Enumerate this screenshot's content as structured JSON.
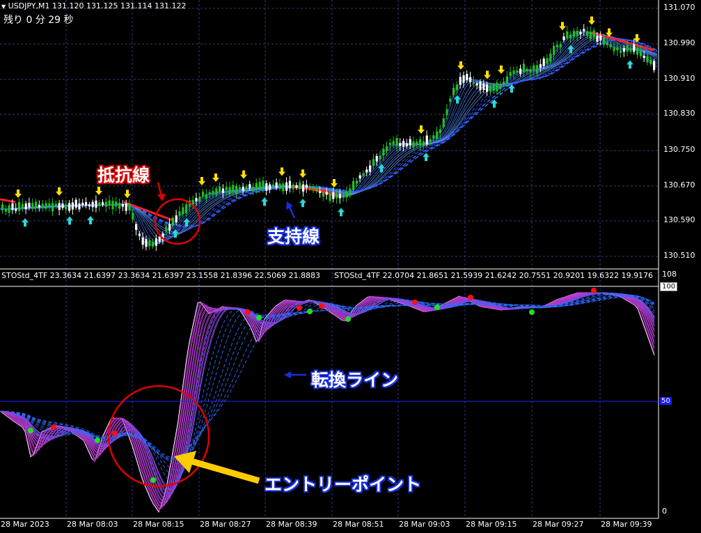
{
  "header": {
    "symbol_info": "USDJPY,M1  131.120 131.125 131.114 131.122",
    "time_left": "残り  0 分 29 秒",
    "indicator_info_left": "STOStd_4TF 23.3634 21.6397 23.3634 21.6397 23.1558 21.8396 22.5069 21.8883",
    "indicator_info_right": "STOStd_4TF 22.0704 21.8651 21.5939 21.6242 20.7551 20.9201 19.6322 19.9176"
  },
  "price_axis": {
    "labels": [
      "131.070",
      "130.990",
      "130.910",
      "130.830",
      "130.750",
      "130.670",
      "130.590",
      "130.510"
    ]
  },
  "indicator_axis": {
    "top": "108",
    "hundred": "100",
    "fifty": "50",
    "zero": "0"
  },
  "time_axis": {
    "labels": [
      "28 Mar 2023",
      "28 Mar 08:03",
      "28 Mar 08:15",
      "28 Mar 08:27",
      "28 Mar 08:39",
      "28 Mar 08:51",
      "28 Mar 09:03",
      "28 Mar 09:15",
      "28 Mar 09:27",
      "28 Mar 09:39"
    ]
  },
  "annotations": {
    "resistance": "抵抗線",
    "support": "支持線",
    "turning_line": "転換ライン",
    "entry_point": "エントリーポイント"
  },
  "colors": {
    "background": "#000000",
    "bull_candle": "#22c022",
    "bear_candle": "#ffffff",
    "up_arrow": "#2ad8d8",
    "down_arrow": "#ffe000",
    "stoch_line": "#d040d0",
    "support_line": "#2060ff",
    "resistance_line": "#ff2020",
    "circle": "#e00000",
    "entry_arrow": "#ffcc00"
  }
}
